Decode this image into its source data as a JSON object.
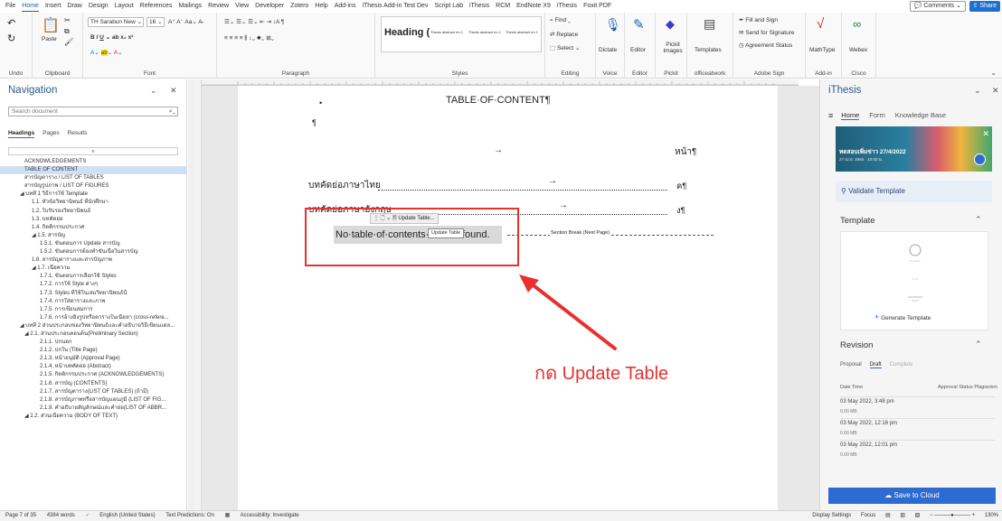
{
  "menu": {
    "items": [
      "File",
      "Home",
      "Insert",
      "Draw",
      "Design",
      "Layout",
      "References",
      "Mailings",
      "Review",
      "View",
      "Developer",
      "Zotero",
      "Help",
      "Add-ins",
      "iThesis Add-in Test Dev",
      "Script Lab",
      "iThesis",
      "RCM",
      "EndNote X9",
      "iThesis",
      "Foxit PDF"
    ],
    "active": "Home",
    "comments": "Comments",
    "share": "Share"
  },
  "ribbon": {
    "undo_label": "Undo",
    "clipboard_label": "Clipboard",
    "paste_label": "Paste",
    "font_label": "Font",
    "font_name": "TH Sarabun New",
    "font_size": "16",
    "paragraph_label": "Paragraph",
    "styles_label": "Styles",
    "heading_style": "Heading (",
    "style_abstract_1": "Thesis abstract en 1",
    "style_abstract_2": "Thesis abstract en 1",
    "style_abstract_3": "Thesis abstract en 1",
    "editing_label": "Editing",
    "find": "Find",
    "replace": "Replace",
    "select": "Select",
    "voice_label": "Voice",
    "dictate": "Dictate",
    "editor_label": "Editor",
    "editor": "Editor",
    "pickit_label": "Pickit",
    "pickit_images": "Pickit Images",
    "officeatwork_label": "officeatwork",
    "templates": "Templates",
    "adobe_label": "Adobe Sign",
    "fill_sign": "Fill and Sign",
    "send_signature": "Send for Signature",
    "agreement_status": "Agreement Status",
    "addin_label": "Add-in",
    "mathtype": "MathType",
    "cisco_label": "Cisco",
    "webex": "Webex"
  },
  "nav": {
    "title": "Navigation",
    "search_placeholder": "Search document",
    "tabs": [
      "Headings",
      "Pages",
      "Results"
    ],
    "active_tab": "Headings",
    "items": [
      {
        "label": "ACKNOWLEDGEMENTS",
        "level": 1
      },
      {
        "label": "TABLE OF CONTENT",
        "level": 1,
        "selected": true
      },
      {
        "label": "สารบัญตาราง / LIST OF TABLES",
        "level": 1
      },
      {
        "label": "สารบัญรูปภาพ / LIST OF FIGURES",
        "level": 1
      },
      {
        "label": "◢ บทที่ 1  วิธีการใช้ Template",
        "level": 0
      },
      {
        "label": "1.1. หัวข้อวิทยานิพนธ์ ที่นักศึกษา",
        "level": 2
      },
      {
        "label": "1.2. ใบรับรองวิทยานิพนธ์",
        "level": 2
      },
      {
        "label": "1.3. บทคัดย่อ",
        "level": 2
      },
      {
        "label": "1.4. กิตติกรรมประกาศ",
        "level": 2
      },
      {
        "label": "◢ 1.5. สารบัญ",
        "level": 2
      },
      {
        "label": "1.5.1. ขั้นตอนการ Update สารบัญ",
        "level": 3
      },
      {
        "label": "1.5.2. ขั้นตอนการต้องทำขั้นเนื้อในสารบัญ",
        "level": 3
      },
      {
        "label": "1.6. สารบัญตารางและสารบัญภาพ",
        "level": 2
      },
      {
        "label": "◢ 1.7. เนื้อความ",
        "level": 2
      },
      {
        "label": "1.7.1. ขั้นตอนการเลือกใช้ Styles",
        "level": 3
      },
      {
        "label": "1.7.2. การใช้ Style ต่างๆ",
        "level": 3
      },
      {
        "label": "1.7.3. Styles ที่ใช้ในเล่มวิทยานิพนธ์นี้",
        "level": 3
      },
      {
        "label": "1.7.4. การใส่ตารางและภาพ",
        "level": 3
      },
      {
        "label": "1.7.5. การเขียนสมการ",
        "level": 3
      },
      {
        "label": "1.7.6. การอ้างอิงรูปหรือตารางในเนื้อหา (cross-refere...",
        "level": 3
      },
      {
        "label": "◢ บทที่ 2  ส่วนประกอบของวิทยานิพนธ์และคำอธิบายวิธีเขียนแต่ล...",
        "level": 0
      },
      {
        "label": "◢ 2.1. ส่วนประกอบตอนต้น(Preliminary Section)",
        "level": 1
      },
      {
        "label": "2.1.1. ปกนอก",
        "level": 3
      },
      {
        "label": "2.1.2. ปกใน (Title Page)",
        "level": 3
      },
      {
        "label": "2.1.3. หน้าอนุมัติ (Approval Page)",
        "level": 3
      },
      {
        "label": "2.1.4. หน้าบทคัดย่อ (Abstract)",
        "level": 3
      },
      {
        "label": "2.1.5. กิตติกรรมประกาศ (ACKNOWLEDGEMENTS)",
        "level": 3
      },
      {
        "label": "2.1.6. สารบัญ (CONTENTS)",
        "level": 3
      },
      {
        "label": "2.1.7. สารบัญตาราง(LIST OF TABLES) (ถ้ามี)",
        "level": 3
      },
      {
        "label": "2.1.8. สารบัญภาพหรือสารบัญแผนภูมิ (LIST OF FIG...",
        "level": 3
      },
      {
        "label": "2.1.9. คำอธิบายสัญลักษณ์และคำย่อ(LIST OF ABBR...",
        "level": 3
      },
      {
        "label": "◢ 2.2. ส่วนเนื้อความ (BODY OF TEXT)",
        "level": 1
      }
    ]
  },
  "doc": {
    "title": "TABLE·OF·CONTENT¶",
    "bullet": "•",
    "pilcrow": "¶",
    "arrow": "→",
    "page_header": "หน้า¶",
    "toc": [
      {
        "label": "บทคัดย่อภาษาไทย",
        "page": "ค¶"
      },
      {
        "label": "บทคัดย่อภาษาอังกฤษ",
        "page": "ง¶"
      }
    ],
    "field_tool": "Update Table...",
    "tooltip": "Update Table",
    "no_entries": "No·table·of·contents·entries·found.",
    "section_break": "Section Break (Next Page)",
    "callout": "กด Update Table"
  },
  "ithesis": {
    "title": "iThesis",
    "tabs": [
      "Home",
      "Form",
      "Knowledge Base"
    ],
    "active_tab": "Home",
    "banner_title": "ทดสอบเพิ่มข่าว 27/4/2022",
    "banner_sub": "27 เม.ย. 2565 · 10:00 น.",
    "validate": "Validate Template",
    "template_h": "Template",
    "generate": "Generate Template",
    "revision_h": "Revision",
    "rev_tabs": [
      "Proposal",
      "Draft",
      "Complete"
    ],
    "rev_active": "Draft",
    "rev_head_left": "Date Time",
    "rev_head_right": "Approval Status  Plagiarism",
    "revisions": [
      {
        "date": "03 May 2022, 3:48 pm",
        "size": "0.00 MB"
      },
      {
        "date": "03 May 2022, 12:16 pm",
        "size": "0.00 MB"
      },
      {
        "date": "03 May 2022, 12:01 pm",
        "size": "0.00 MB"
      }
    ],
    "save": "Save to Cloud"
  },
  "status": {
    "page": "Page 7 of 35",
    "words": "4384 words",
    "language": "English (United States)",
    "predictions": "Text Predictions: On",
    "accessibility": "Accessibility: Investigate",
    "display": "Display Settings",
    "focus": "Focus",
    "zoom": "130%"
  }
}
